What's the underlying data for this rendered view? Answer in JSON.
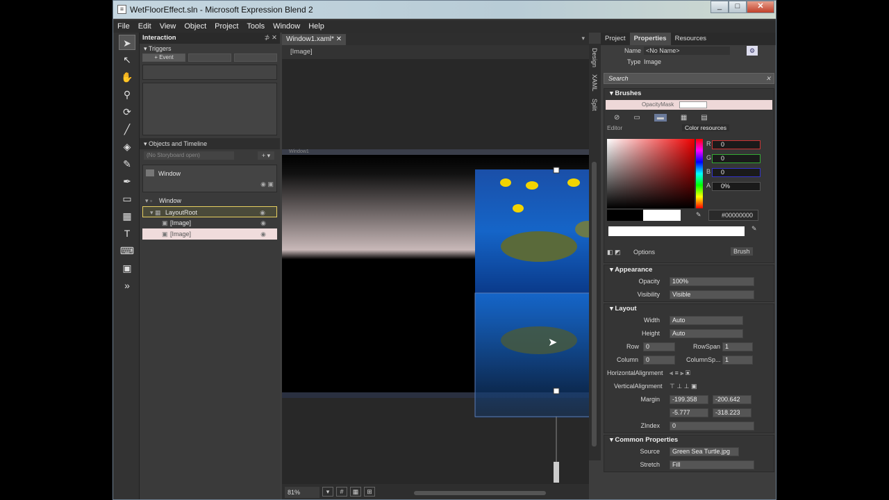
{
  "window": {
    "title": "WetFloorEffect.sln - Microsoft Expression Blend 2"
  },
  "window_controls": [
    "_",
    "□",
    "✕"
  ],
  "menu": [
    "File",
    "Edit",
    "View",
    "Object",
    "Project",
    "Tools",
    "Window",
    "Help"
  ],
  "toolbox": {
    "tools": [
      "selection-tool",
      "direct-selection-tool",
      "pan-tool",
      "zoom-tool",
      "camera-orbit-tool",
      "eyedropper-tool",
      "paint-bucket-tool",
      "brush-transform-tool",
      "pen-tool",
      "rectangle-tool",
      "layout-panel-tool",
      "text-tool",
      "input-control-tool",
      "asset-library-tool",
      "more-tools"
    ]
  },
  "interaction": {
    "title": "Interaction",
    "triggers": {
      "label": "Triggers",
      "buttons": [
        "+ Event",
        "",
        ""
      ]
    },
    "objects": {
      "label": "Objects and Timeline",
      "storyboard": "(No Storyboard open)",
      "scope": "Window",
      "tree": [
        {
          "label": "Window",
          "depth": 0
        },
        {
          "label": "LayoutRoot",
          "depth": 1
        },
        {
          "label": "[Image]",
          "depth": 2
        },
        {
          "label": "[Image]",
          "depth": 2
        }
      ]
    }
  },
  "document": {
    "tab": "Window1.xaml*",
    "breadcrumb": "[Image]",
    "window_label": "Window1"
  },
  "status": {
    "zoom": "81%"
  },
  "view_tabs": [
    "Design",
    "XAML",
    "Split"
  ],
  "right_tabs": [
    "Project",
    "Properties",
    "Resources"
  ],
  "properties": {
    "name_label": "Name",
    "name_value": "<No Name>",
    "type_label": "Type",
    "type_value": "Image",
    "search": "Search",
    "brushes": {
      "title": "Brushes",
      "opacity_mask": "OpacityMask",
      "editor": "Editor",
      "color_resources": "Color resources",
      "channels": [
        {
          "label": "R",
          "value": "0"
        },
        {
          "label": "G",
          "value": "0"
        },
        {
          "label": "B",
          "value": "0"
        },
        {
          "label": "A",
          "value": "0%"
        }
      ],
      "hex": "#00000000",
      "options": "Options",
      "brush": "Brush"
    },
    "appearance": {
      "title": "Appearance",
      "opacity_label": "Opacity",
      "opacity_value": "100%",
      "visibility_label": "Visibility",
      "visibility_value": "Visible"
    },
    "layout": {
      "title": "Layout",
      "width_label": "Width",
      "width_value": "Auto",
      "height_label": "Height",
      "height_value": "Auto",
      "row_label": "Row",
      "row_value": "0",
      "rowspan_label": "RowSpan",
      "rowspan_value": "1",
      "column_label": "Column",
      "column_value": "0",
      "columnspan_label": "ColumnSp...",
      "columnspan_value": "1",
      "halign_label": "HorizontalAlignment",
      "valign_label": "VerticalAlignment",
      "margin_label": "Margin",
      "margin_left": "-199.358",
      "margin_right": "-200.642",
      "margin_top": "-5.777",
      "margin_bottom": "-318.223",
      "zindex_label": "ZIndex",
      "zindex_value": "0"
    },
    "common": {
      "title": "Common Properties",
      "source_label": "Source",
      "source_value": "Green Sea Turtle.jpg",
      "stretch_label": "Stretch",
      "stretch_value": "Fill"
    }
  },
  "colors": {
    "accent": "#e8d060",
    "selection": "#5b7db8",
    "chrome": "#3d3d3d"
  }
}
